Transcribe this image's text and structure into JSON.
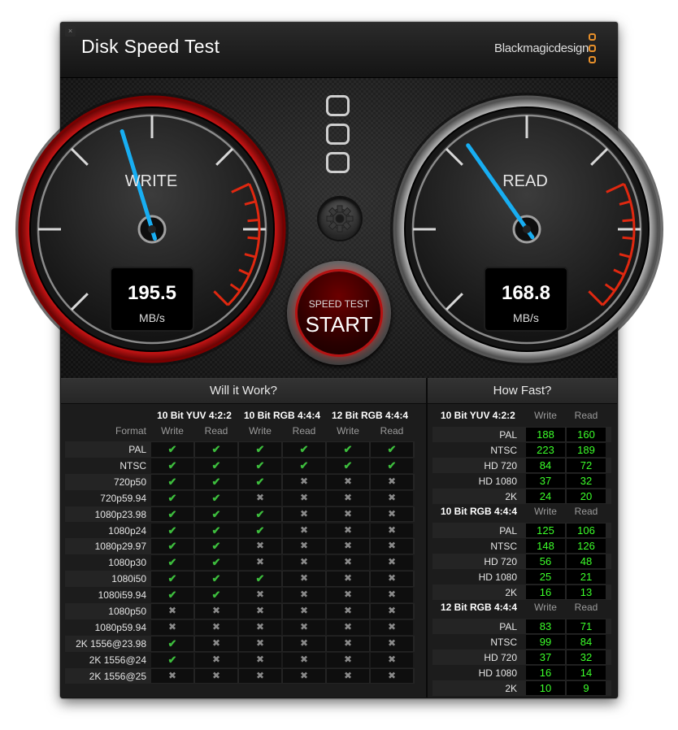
{
  "window": {
    "title": "Disk Speed Test",
    "brand": "Blackmagicdesign",
    "close_glyph": "×"
  },
  "icons": {
    "close": "close-icon",
    "menu": "menu-squares-icon",
    "settings": "gear-icon",
    "check": "checkmark-icon",
    "cross": "cross-icon"
  },
  "colors": {
    "accent_red": "#c0140f",
    "needle_blue": "#1aaef0",
    "ok_green": "#3dbd3d",
    "speed_green": "#3cff2a",
    "brand_orange": "#e8902a"
  },
  "gauges": {
    "write": {
      "label": "WRITE",
      "value": "195.5",
      "unit": "MB/s"
    },
    "read": {
      "label": "READ",
      "value": "168.8",
      "unit": "MB/s"
    }
  },
  "start_button": {
    "small_label": "SPEED TEST",
    "big_label": "START"
  },
  "will_it_work": {
    "title": "Will it Work?",
    "format_label": "Format",
    "groups": [
      "10 Bit YUV 4:2:2",
      "10 Bit RGB 4:4:4",
      "12 Bit RGB 4:4:4"
    ],
    "col_labels": [
      "Write",
      "Read",
      "Write",
      "Read",
      "Write",
      "Read"
    ],
    "rows": [
      {
        "format": "PAL",
        "marks": [
          1,
          1,
          1,
          1,
          1,
          1
        ]
      },
      {
        "format": "NTSC",
        "marks": [
          1,
          1,
          1,
          1,
          1,
          1
        ]
      },
      {
        "format": "720p50",
        "marks": [
          1,
          1,
          1,
          0,
          0,
          0
        ]
      },
      {
        "format": "720p59.94",
        "marks": [
          1,
          1,
          0,
          0,
          0,
          0
        ]
      },
      {
        "format": "1080p23.98",
        "marks": [
          1,
          1,
          1,
          0,
          0,
          0
        ]
      },
      {
        "format": "1080p24",
        "marks": [
          1,
          1,
          1,
          0,
          0,
          0
        ]
      },
      {
        "format": "1080p29.97",
        "marks": [
          1,
          1,
          0,
          0,
          0,
          0
        ]
      },
      {
        "format": "1080p30",
        "marks": [
          1,
          1,
          0,
          0,
          0,
          0
        ]
      },
      {
        "format": "1080i50",
        "marks": [
          1,
          1,
          1,
          0,
          0,
          0
        ]
      },
      {
        "format": "1080i59.94",
        "marks": [
          1,
          1,
          0,
          0,
          0,
          0
        ]
      },
      {
        "format": "1080p50",
        "marks": [
          0,
          0,
          0,
          0,
          0,
          0
        ]
      },
      {
        "format": "1080p59.94",
        "marks": [
          0,
          0,
          0,
          0,
          0,
          0
        ]
      },
      {
        "format": "2K 1556@23.98",
        "marks": [
          1,
          0,
          0,
          0,
          0,
          0
        ]
      },
      {
        "format": "2K 1556@24",
        "marks": [
          1,
          0,
          0,
          0,
          0,
          0
        ]
      },
      {
        "format": "2K 1556@25",
        "marks": [
          0,
          0,
          0,
          0,
          0,
          0
        ]
      }
    ]
  },
  "how_fast": {
    "title": "How Fast?",
    "col_labels": [
      "Write",
      "Read"
    ],
    "groups": [
      {
        "name": "10 Bit YUV 4:2:2",
        "rows": [
          [
            "PAL",
            "188",
            "160"
          ],
          [
            "NTSC",
            "223",
            "189"
          ],
          [
            "HD 720",
            "84",
            "72"
          ],
          [
            "HD 1080",
            "37",
            "32"
          ],
          [
            "2K",
            "24",
            "20"
          ]
        ]
      },
      {
        "name": "10 Bit RGB 4:4:4",
        "rows": [
          [
            "PAL",
            "125",
            "106"
          ],
          [
            "NTSC",
            "148",
            "126"
          ],
          [
            "HD 720",
            "56",
            "48"
          ],
          [
            "HD 1080",
            "25",
            "21"
          ],
          [
            "2K",
            "16",
            "13"
          ]
        ]
      },
      {
        "name": "12 Bit RGB 4:4:4",
        "rows": [
          [
            "PAL",
            "83",
            "71"
          ],
          [
            "NTSC",
            "99",
            "84"
          ],
          [
            "HD 720",
            "37",
            "32"
          ],
          [
            "HD 1080",
            "16",
            "14"
          ],
          [
            "2K",
            "10",
            "9"
          ]
        ]
      }
    ]
  }
}
